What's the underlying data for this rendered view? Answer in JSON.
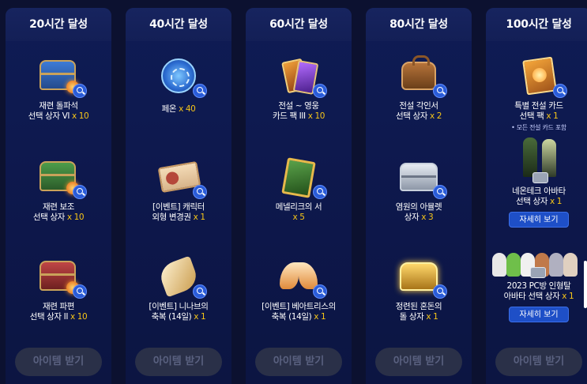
{
  "columns": [
    {
      "header": "20시간 달성",
      "claim_label": "아이템 받기",
      "items": [
        {
          "name": "재련 돌파석",
          "name2": "선택 상자 VI",
          "qty": "x 10",
          "icon": "chest-blue-icon"
        },
        {
          "name": "재련 보조",
          "name2": "선택 상자",
          "qty": "x 10",
          "icon": "chest-green-icon"
        },
        {
          "name": "재련 파편",
          "name2": "선택 상자 II",
          "qty": "x 10",
          "icon": "chest-red-icon"
        }
      ]
    },
    {
      "header": "40시간 달성",
      "claim_label": "아이템 받기",
      "items": [
        {
          "name": "페온",
          "name2": "",
          "qty": "x 40",
          "icon": "pheon-coin-icon"
        },
        {
          "name": "[이벤트] 캐릭터",
          "name2": "외형 변경권",
          "qty": "x 1",
          "icon": "ticket-icon"
        },
        {
          "name": "[이벤트] 니나브의",
          "name2": "축복 (14일)",
          "qty": "x 1",
          "icon": "wing-icon"
        }
      ]
    },
    {
      "header": "60시간 달성",
      "claim_label": "아이템 받기",
      "items": [
        {
          "name": "전설 ~ 영웅",
          "name2": "카드 팩 III",
          "qty": "x 10",
          "icon": "card-pack-icon"
        },
        {
          "name": "메넬리크의 서",
          "name2": "",
          "qty": "x 5",
          "icon": "green-book-icon"
        },
        {
          "name": "[이벤트] 베아트리스의",
          "name2": "축복 (14일)",
          "qty": "x 1",
          "icon": "wings-icon"
        }
      ]
    },
    {
      "header": "80시간 달성",
      "claim_label": "아이템 받기",
      "items": [
        {
          "name": "전설 각인서",
          "name2": "선택 상자",
          "qty": "x 2",
          "icon": "bag-icon"
        },
        {
          "name": "염원의 아뮬렛",
          "name2": "상자",
          "qty": "x 3",
          "icon": "silver-chest-icon"
        },
        {
          "name": "정련된 혼돈의",
          "name2": "돌 상자",
          "qty": "x 1",
          "icon": "gold-chest-icon"
        }
      ]
    },
    {
      "header": "100시간 달성",
      "claim_label": "아이템 받기",
      "items": [
        {
          "name": "특별 전설 카드",
          "name2": "선택 팩",
          "qty": "x 1",
          "note": "• 모든 전설 카드 포함",
          "icon": "book-icon"
        },
        {
          "name": "네온테크 아바타",
          "name2": "선택 상자",
          "qty": "x 1",
          "detail": "자세히 보기",
          "icon": "avatar-icon"
        },
        {
          "name": "2023 PC방 인형탈",
          "name2": "아바타 선택 상자",
          "qty": "x 1",
          "detail": "자세히 보기",
          "icon": "plush-avatar-icon"
        }
      ]
    }
  ]
}
